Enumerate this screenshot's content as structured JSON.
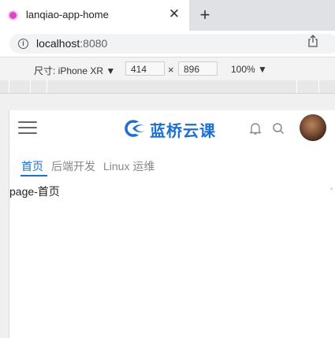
{
  "browser": {
    "tab": {
      "title": "lanqiao-app-home",
      "close": "✕"
    },
    "new_tab": "+",
    "url": {
      "host": "localhost",
      "port": ":8080"
    }
  },
  "devtools": {
    "device_label": "尺寸: iPhone XR ▼",
    "width": "414",
    "times": "×",
    "height": "896",
    "zoom": "100% ▼"
  },
  "app": {
    "logo_text": "蓝桥云课",
    "nav": [
      {
        "label": "首页",
        "active": true
      },
      {
        "label": "后端开发",
        "active": false
      },
      {
        "label": "Linux 运维",
        "active": false
      }
    ],
    "content": "page-首页"
  },
  "colors": {
    "accent": "#1e6fd0",
    "favicon": "#d946c8"
  }
}
